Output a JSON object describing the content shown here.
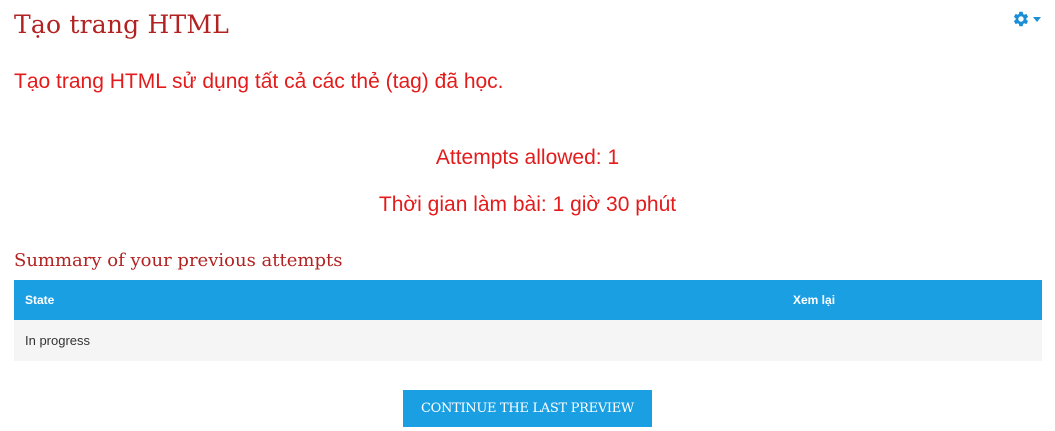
{
  "header": {
    "title": "Tạo trang HTML",
    "settings_icon": "gear-icon",
    "caret_icon": "caret-down-icon",
    "accent_color": "#1a8fd6"
  },
  "intro": {
    "text": "Tạo trang HTML sử dụng tất cả các thẻ (tag) đã học."
  },
  "quiz_info": {
    "attempts_allowed": "Attempts allowed: 1",
    "time_limit": "Thời gian làm bài: 1 giờ 30 phút"
  },
  "summary": {
    "title": "Summary of your previous attempts",
    "columns": [
      "State",
      "Xem lại"
    ],
    "rows": [
      {
        "state": "In progress",
        "review": ""
      }
    ]
  },
  "actions": {
    "continue_label": "CONTINUE THE LAST PREVIEW"
  },
  "colors": {
    "title": "#b22222",
    "text_red": "#e31b1b",
    "table_header": "#1a9fe3",
    "row_bg": "#f5f5f5"
  }
}
